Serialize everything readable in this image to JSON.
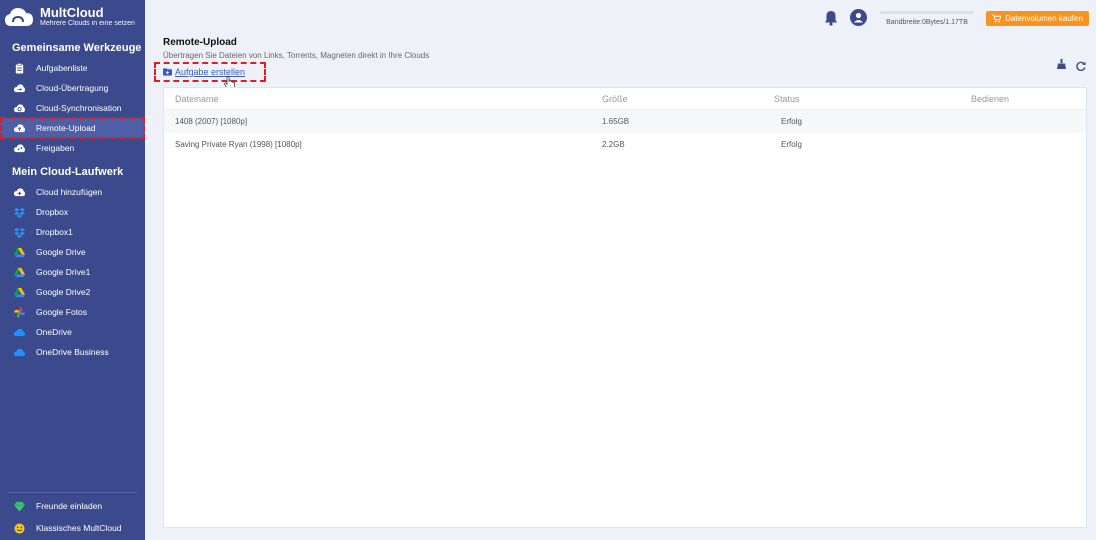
{
  "brand": {
    "name": "MultCloud",
    "tagline": "Mehrere Clouds in eine setzen"
  },
  "sidebar": {
    "section_tools": "Gemeinsame Werkzeuge",
    "tools": [
      {
        "label": "Aufgabenliste",
        "icon": "clipboard-icon"
      },
      {
        "label": "Cloud-Übertragung",
        "icon": "cloud-transfer-icon"
      },
      {
        "label": "Cloud-Synchronisation",
        "icon": "cloud-sync-icon"
      },
      {
        "label": "Remote-Upload",
        "icon": "cloud-upload-icon",
        "active": true
      },
      {
        "label": "Freigaben",
        "icon": "share-icon"
      }
    ],
    "section_drive": "Mein Cloud-Laufwerk",
    "drives": [
      {
        "label": "Cloud hinzufügen",
        "icon": "cloud-add-icon"
      },
      {
        "label": "Dropbox",
        "icon": "dropbox-icon"
      },
      {
        "label": "Dropbox1",
        "icon": "dropbox-icon"
      },
      {
        "label": "Google Drive",
        "icon": "google-drive-icon"
      },
      {
        "label": "Google Drive1",
        "icon": "google-drive-icon"
      },
      {
        "label": "Google Drive2",
        "icon": "google-drive-icon"
      },
      {
        "label": "Google Fotos",
        "icon": "google-photos-icon"
      },
      {
        "label": "OneDrive",
        "icon": "onedrive-icon"
      },
      {
        "label": "OneDrive Business",
        "icon": "onedrive-icon"
      }
    ],
    "bottom": [
      {
        "label": "Freunde einladen",
        "icon": "diamond-icon"
      },
      {
        "label": "Klassisches MultCloud",
        "icon": "smiley-icon"
      }
    ]
  },
  "topbar": {
    "bandwidth_text": "Bandbreite:0Bytes/1.17TB",
    "bandwidth_used_fraction": 0,
    "buy_label": "Datenvolumen kaufen"
  },
  "main": {
    "title": "Remote-Upload",
    "subtitle": "Übertragen Sie Dateien von Links, Torrents, Magneten direkt in Ihre Clouds",
    "create_task": "Aufgabe erstellen",
    "table": {
      "headers": [
        "Dateiname",
        "Größe",
        "Status",
        "Bedienen"
      ],
      "rows": [
        {
          "name": "1408 (2007) [1080p]",
          "size": "1.65GB",
          "status": "Erfolg"
        },
        {
          "name": "Saving Private Ryan (1998) [1080p]",
          "size": "2.2GB",
          "status": "Erfolg"
        }
      ]
    }
  },
  "colors": {
    "sidebar_bg": "#3b4a8c",
    "accent_orange": "#f7931e",
    "link_blue": "#3b5cc4",
    "highlight_red": "#e21c24"
  }
}
